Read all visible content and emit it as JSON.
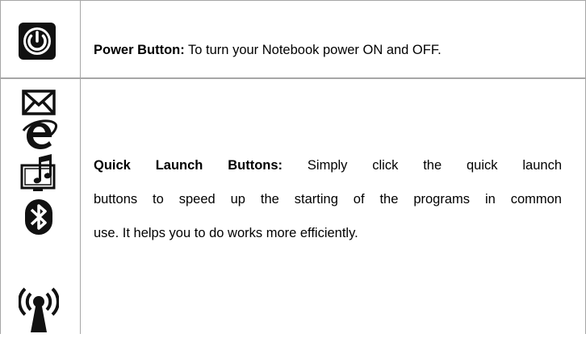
{
  "rows": [
    {
      "icons": [
        "power-icon"
      ],
      "title": "Power Button:",
      "text": " To turn your Notebook power ON and OFF."
    },
    {
      "icons": [
        "mail-icon",
        "internet-explorer-icon",
        "media-player-icon",
        "bluetooth-icon",
        "wireless-icon"
      ],
      "title": "Quick Launch Buttons:",
      "lines": [
        " Simply click the quick launch",
        "buttons to speed up the starting of the programs in common",
        "use. It helps you to do works more efficiently."
      ]
    }
  ]
}
